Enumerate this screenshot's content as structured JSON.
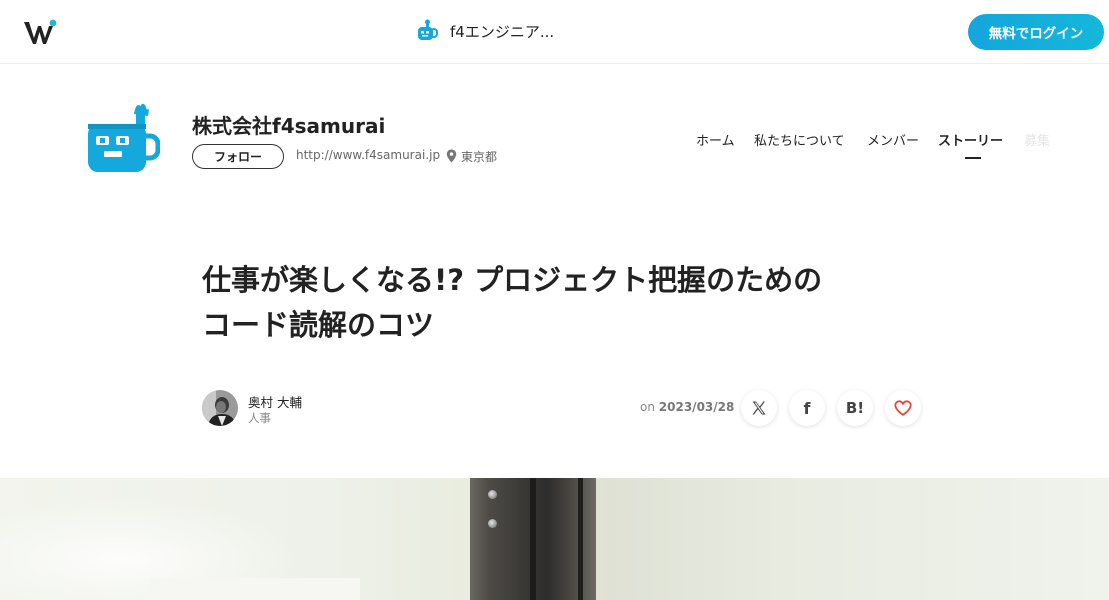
{
  "topbar": {
    "logo_icon": "wantedly-w-logo-icon",
    "company_short_title": "f4エンジニア...",
    "login_button": "無料でログイン",
    "colors": {
      "brand_blue": "#15a5dd"
    }
  },
  "company": {
    "name": "株式会社f4samurai",
    "follow_button": "フォロー",
    "url": "http://www.f4samurai.jp",
    "location_icon": "map-pin-icon",
    "location": "東京都",
    "logo_color": "#14a8dd"
  },
  "nav": {
    "items": [
      {
        "label": "ホーム"
      },
      {
        "label": "私たちについて"
      },
      {
        "label": "メンバー"
      },
      {
        "label": "ストーリー",
        "active": true
      },
      {
        "label": "募集"
      }
    ]
  },
  "article": {
    "title_line1": "仕事が楽しくなる!? プロジェクト把握のための",
    "title_line2": "コード読解のコツ",
    "author": {
      "name": "奥村 大輔",
      "role": "人事"
    },
    "date_prefix": "on",
    "date": "2023/03/28",
    "share": [
      {
        "icon": "x-twitter-icon",
        "glyph": "𝕏"
      },
      {
        "icon": "facebook-icon",
        "glyph": "f"
      },
      {
        "icon": "hatena-bookmark-icon",
        "glyph": "B!"
      },
      {
        "icon": "heart-icon"
      }
    ],
    "heart_color": "#e0483e"
  }
}
